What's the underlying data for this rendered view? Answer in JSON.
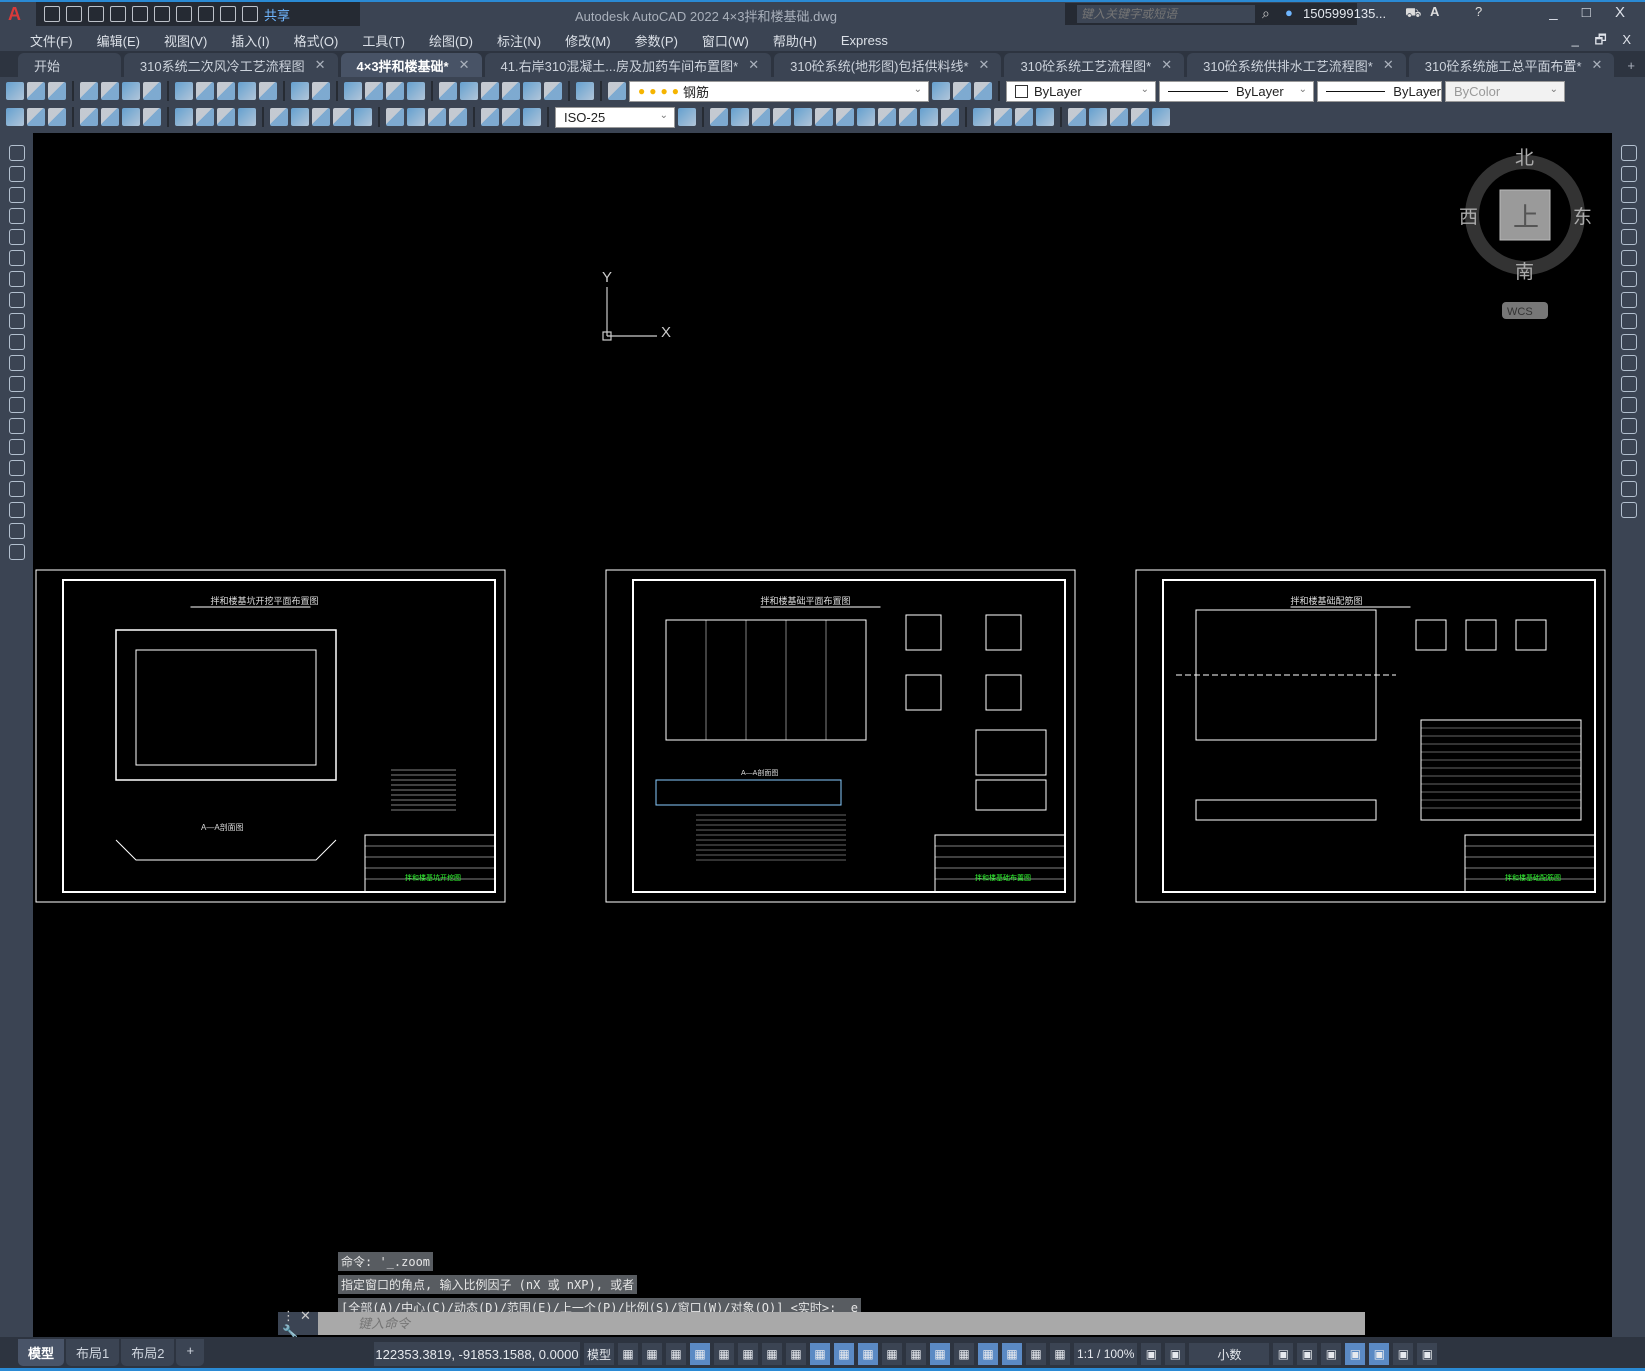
{
  "app": {
    "title": "Autodesk AutoCAD 2022    4×3拌和楼基础.dwg",
    "logo": "A",
    "share_label": "共享",
    "colors": {
      "accent": "#2a8ad4",
      "canvas": "#000000",
      "chrome": "#3b4453"
    }
  },
  "search": {
    "placeholder": "键入关键字或短语",
    "user": "1505999135...",
    "icons": [
      "search-icon",
      "user-icon",
      "cart-icon",
      "autodesk-app-icon",
      "help-icon"
    ]
  },
  "window_controls": {
    "app": "_ □ X",
    "doc": "_ 🗗 X"
  },
  "quick_access": [
    "new-icon",
    "open-icon",
    "save-icon",
    "save-as-icon",
    "publish-icon",
    "export-icon",
    "plot-icon",
    "undo-icon",
    "redo-icon",
    "customize-icon"
  ],
  "menu": [
    "文件(F)",
    "编辑(E)",
    "视图(V)",
    "插入(I)",
    "格式(O)",
    "工具(T)",
    "绘图(D)",
    "标注(N)",
    "修改(M)",
    "参数(P)",
    "窗口(W)",
    "帮助(H)",
    "Express"
  ],
  "tabs": [
    {
      "label": "开始",
      "closable": false,
      "active": false
    },
    {
      "label": "310系统二次风冷工艺流程图",
      "closable": true,
      "active": false
    },
    {
      "label": "4×3拌和楼基础*",
      "closable": true,
      "active": true
    },
    {
      "label": "41.右岸310混凝土...房及加药车间布置图*",
      "closable": true,
      "active": false
    },
    {
      "label": "310砼系统(地形图)包括供料线*",
      "closable": true,
      "active": false
    },
    {
      "label": "310砼系统工艺流程图*",
      "closable": true,
      "active": false
    },
    {
      "label": "310砼系统供排水工艺流程图*",
      "closable": true,
      "active": false
    },
    {
      "label": "310砼系统施工总平面布置*",
      "closable": true,
      "active": false
    }
  ],
  "toolbar": {
    "row1_icons": [
      "new-icon",
      "open-icon",
      "save-icon",
      "|",
      "plot-icon",
      "plot-preview-icon",
      "publish-icon",
      "3d-print-icon",
      "|",
      "cut-icon",
      "copy-icon",
      "paste-icon",
      "match-properties-icon",
      "block-editor-icon",
      "|",
      "undo-icon",
      "redo-icon",
      "|",
      "pan-icon",
      "zoom-realtime-icon",
      "zoom-window-icon",
      "zoom-previous-icon",
      "|",
      "properties-icon",
      "design-center-icon",
      "tool-palettes-icon",
      "sheet-set-icon",
      "markup-icon",
      "quickcalc-icon",
      "|",
      "help-icon",
      "|",
      "layer-properties-icon"
    ],
    "layer": "钢筋",
    "layer_icons": [
      "layer-on-icon",
      "layer-freeze-icon",
      "layer-viewport-icon",
      "layer-lock-icon"
    ],
    "layer_tool_icons": [
      "make-current-icon",
      "layer-previous-icon",
      "layer-states-icon"
    ],
    "color": "ByLayer",
    "linetype": "ByLayer",
    "lineweight": "ByLayer",
    "plotstyle": "ByColor",
    "row2_icons": [
      "text-edit-icon",
      "spell-check-icon",
      "layer-icon",
      "|",
      "linear-dim-icon",
      "aligned-dim-icon",
      "arc-length-icon",
      "ordinate-icon",
      "|",
      "radius-icon",
      "jogged-icon",
      "diameter-icon",
      "angular-icon",
      "|",
      "quick-dim-icon",
      "baseline-icon",
      "continue-icon",
      "space-icon",
      "break-icon",
      "|",
      "tolerance-icon",
      "center-mark-icon",
      "inspect-icon",
      "jogged-linear-icon",
      "|",
      "dim-edit-icon",
      "dim-text-edit-icon",
      "dim-update-icon"
    ],
    "dimstyle": "ISO-25",
    "row2b_icons": [
      "dimstyle-icon",
      "|",
      "solid-icon",
      "union-icon",
      "subtract-icon",
      "intersect-icon",
      "extrude-icon",
      "move3d-icon",
      "copy-faces-icon",
      "delete-faces-icon",
      "rotate-faces-icon",
      "taper-faces-icon",
      "color-faces-icon",
      "color-edges-icon",
      "|",
      "imprint-icon",
      "clean-icon",
      "separate-icon",
      "shell-icon",
      "|",
      "check-icon",
      "slice-icon",
      "section-icon",
      "interfere-icon",
      "solid-check-icon"
    ]
  },
  "left_tools": [
    "line-icon",
    "construction-line-icon",
    "polyline-icon",
    "polygon-icon",
    "rectangle-icon",
    "arc-icon",
    "circle-icon",
    "revision-cloud-icon",
    "spline-icon",
    "ellipse-icon",
    "ellipse-arc-icon",
    "insert-block-icon",
    "make-block-icon",
    "point-icon",
    "hatch-icon",
    "gradient-icon",
    "region-icon",
    "table-icon",
    "mtext-icon",
    "add-selected-icon"
  ],
  "right_tools": [
    "erase-icon",
    "copy-icon",
    "mirror-icon",
    "offset-icon",
    "array-icon",
    "move-icon",
    "rotate-icon",
    "scale-icon",
    "stretch-icon",
    "trim-icon",
    "extend-icon",
    "break-at-point-icon",
    "break-icon",
    "join-icon",
    "chamfer-icon",
    "fillet-icon",
    "blend-icon",
    "explode-icon"
  ],
  "viewcube": {
    "north": "北",
    "south": "南",
    "east": "东",
    "west": "西",
    "face": "上",
    "wcs": "WCS"
  },
  "ucs": {
    "x": "X",
    "y": "Y"
  },
  "drawings": [
    {
      "title": "拌和楼基坑开挖平面布置图",
      "section": "A—A剖面图",
      "sheet": "拌和楼基坑开挖图"
    },
    {
      "title": "拌和楼基础平面布置图",
      "section": "A—A剖面图",
      "sheet": "拌和楼基础布置图"
    },
    {
      "title": "拌和楼基础配筋图",
      "section": "",
      "sheet": "拌和楼基础配筋图"
    }
  ],
  "command": {
    "history": [
      "命令: '_.zoom",
      "指定窗口的角点, 输入比例因子 (nX 或 nXP), 或者",
      "[全部(A)/中心(C)/动态(D)/范围(E)/上一个(P)/比例(S)/窗口(W)/对象(O)] <实时>: _e"
    ],
    "placeholder": "键入命令"
  },
  "layout_tabs": [
    "模型",
    "布局1",
    "布局2",
    "+"
  ],
  "status": {
    "coords": "122353.3819, -91853.1588, 0.0000",
    "space": "模型",
    "scale": "1:1 / 100%",
    "units": "小数",
    "tools": [
      {
        "n": "grid-icon",
        "on": false
      },
      {
        "n": "snap-icon",
        "on": false
      },
      {
        "n": "infer-constraints-icon",
        "on": false
      },
      {
        "n": "dynamic-input-icon",
        "on": true
      },
      {
        "n": "ortho-icon",
        "on": false
      },
      {
        "n": "polar-icon",
        "on": false
      },
      {
        "n": "isodraft-icon",
        "on": false
      },
      {
        "n": "object-snap-tracking-icon",
        "on": false
      },
      {
        "n": "object-snap-icon",
        "on": true
      },
      {
        "n": "lineweight-icon",
        "on": true
      },
      {
        "n": "transparency-icon",
        "on": true
      },
      {
        "n": "selection-cycling-icon",
        "on": false
      },
      {
        "n": "3d-osnap-icon",
        "on": false
      },
      {
        "n": "dynamic-ucs-icon",
        "on": true
      },
      {
        "n": "selection-filter-icon",
        "on": false
      },
      {
        "n": "gizmo-icon",
        "on": true
      },
      {
        "n": "annotation-visibility-icon",
        "on": true
      },
      {
        "n": "auto-scale-icon",
        "on": false
      },
      {
        "n": "annotation-scale-icon",
        "on": false
      }
    ],
    "tools_right": [
      "workspace-icon",
      "annotation-monitor-icon",
      "units-icon",
      "quick-properties-icon",
      "lock-ui-icon",
      "isolate-icon",
      "graphics-performance-icon",
      "clean-screen-icon",
      "customize-icon"
    ]
  }
}
